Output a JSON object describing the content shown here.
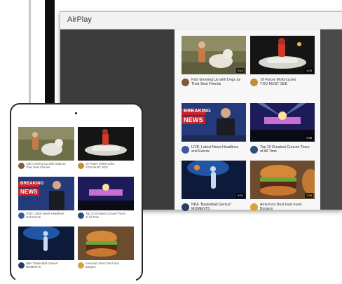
{
  "tv": {
    "title": "AirPlay",
    "videos": [
      {
        "caption": "Kids Growing Up with Dogs as\nTheir Best Friends",
        "duration": "2:14"
      },
      {
        "caption": "10 Future Motorcycles\nYOU MUST SEE",
        "duration": "4:05"
      },
      {
        "caption": "LIVE: Latest News Headlines\nand Events",
        "duration": ""
      },
      {
        "caption": "Top 10 Greatest Concert Tours\nof All Time",
        "duration": "9:58"
      },
      {
        "caption": "NBA \"Basketball Genius\"\nMOMENTS",
        "duration": "5:21"
      },
      {
        "caption": "America's Best Fast Food\nBurgers",
        "duration": "7:40"
      }
    ]
  },
  "tablet": {
    "videos": [
      {
        "caption": "Kids Growing Up with Dogs as\nTheir Best Friends"
      },
      {
        "caption": "10 Future Motorcycles\nYOU MUST SEE"
      },
      {
        "caption": "LIVE: Latest News Headlines\nand Events"
      },
      {
        "caption": "Top 10 Greatest Concert Tours\nof All Time"
      },
      {
        "caption": "NBA \"Basketball Genius\"\nMOMENTS"
      },
      {
        "caption": "America's Best Fast Food\nBurgers"
      }
    ]
  },
  "thumb_text": {
    "breaking": "BREAKING",
    "news": "NEWS"
  }
}
